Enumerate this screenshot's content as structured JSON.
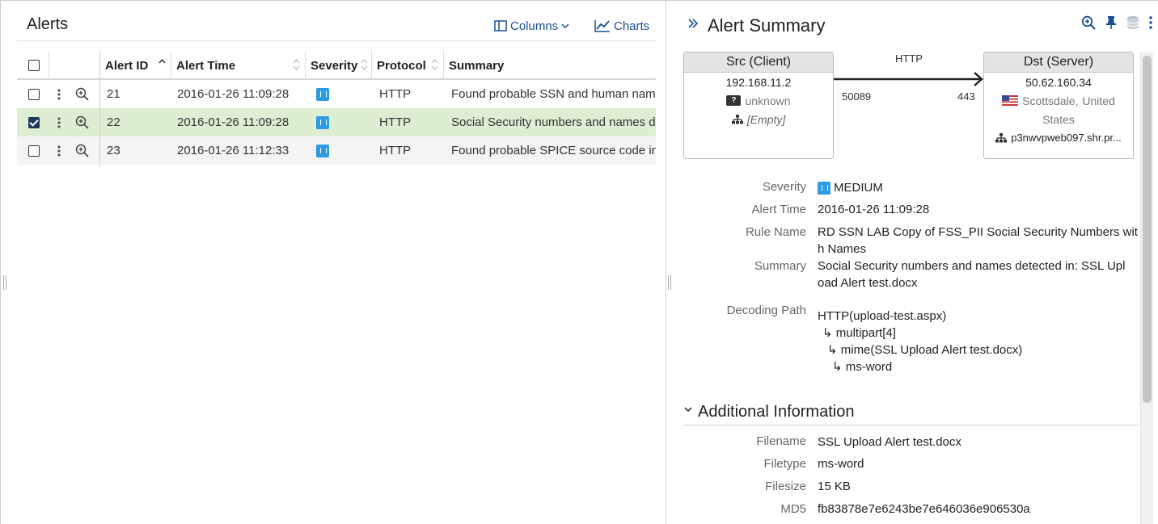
{
  "alerts_panel": {
    "title": "Alerts",
    "columns_btn": "Columns",
    "charts_btn": "Charts",
    "headers": [
      "Alert ID",
      "Alert Time",
      "Severity",
      "Protocol",
      "Summary"
    ],
    "rows": [
      {
        "id": "21",
        "time": "2016-01-26 11:09:28",
        "protocol": "HTTP",
        "summary": "Found probable SSN and human names",
        "checked": false
      },
      {
        "id": "22",
        "time": "2016-01-26 11:09:28",
        "protocol": "HTTP",
        "summary": "Social Security numbers and names detected",
        "checked": true
      },
      {
        "id": "23",
        "time": "2016-01-26 11:12:33",
        "protocol": "HTTP",
        "summary": "Found probable SPICE source code in",
        "checked": false
      }
    ]
  },
  "summary_panel": {
    "title": "Alert Summary",
    "src": {
      "header": "Src (Client)",
      "ip": "192.168.11.2",
      "host_badge": "?",
      "host": "unknown",
      "network": "[Empty]",
      "port": "50089"
    },
    "dst": {
      "header": "Dst (Server)",
      "ip": "50.62.160.34",
      "location_city": "Scottsdale,",
      "location_country": "United",
      "location_country2": "States",
      "network": "p3nwvpweb097.shr.pr...",
      "port": "443"
    },
    "protocol": "HTTP",
    "fields": {
      "severity_label": "Severity",
      "severity_value": "MEDIUM",
      "alert_time_label": "Alert Time",
      "alert_time_value": "2016-01-26 11:09:28",
      "rule_name_label": "Rule Name",
      "rule_name_line1": "RD SSN LAB Copy of FSS_PII Social Security Numbers wit",
      "rule_name_line2": "h Names",
      "summary_label": "Summary",
      "summary_line1": "Social Security numbers and names detected in: SSL Upl",
      "summary_line2": "oad Alert test.docx",
      "decoding_label": "Decoding Path",
      "decoding": [
        "HTTP(upload-test.aspx)",
        "↳ multipart[4]",
        "↳ mime(SSL Upload Alert test.docx)",
        "↳ ms-word"
      ]
    },
    "additional": {
      "title": "Additional Information",
      "filename_label": "Filename",
      "filename_value": "SSL Upload Alert test.docx",
      "filetype_label": "Filetype",
      "filetype_value": "ms-word",
      "filesize_label": "Filesize",
      "filesize_value": "15 KB",
      "md5_label": "MD5",
      "md5_value": "fb83878e7e6243be7e646036e906530a"
    }
  },
  "colors": {
    "link": "#1a4f91",
    "selected_row": "#ddeed3",
    "severity_medium": "#2f9be3"
  }
}
